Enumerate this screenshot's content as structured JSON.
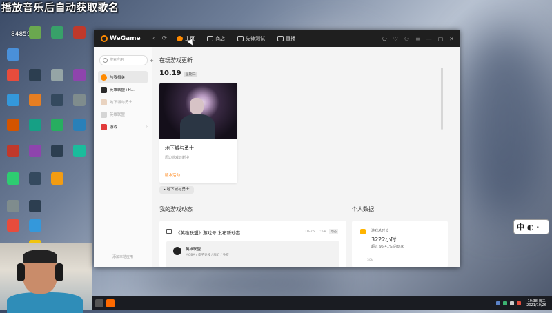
{
  "overlay": {
    "title": "播放音乐后自动获取歌名",
    "counter": "8485959"
  },
  "window": {
    "app_name": "WeGame",
    "nav": {
      "back": "‹",
      "refresh": "⟳"
    },
    "tabs": [
      {
        "label": "主页",
        "active": true
      },
      {
        "label": "商店",
        "active": false
      },
      {
        "label": "先锋测试",
        "active": false
      },
      {
        "label": "直播",
        "active": false
      }
    ],
    "title_controls": [
      "⎔",
      "♡",
      "⚇",
      "≡",
      "—",
      "▢",
      "✕"
    ]
  },
  "sidebar": {
    "search_placeholder": "搜索应用",
    "add": "+",
    "items": [
      {
        "label": "与我相关",
        "color": "#ff8a00"
      },
      {
        "label": "英雄联盟+H...",
        "color": "#2b2b2b"
      },
      {
        "label": "地下城与勇士",
        "color": "#e9d3c0"
      },
      {
        "label": "英雄联盟",
        "color": "#d5d5d5"
      },
      {
        "label": "游戏",
        "color": "#e23b3b"
      }
    ],
    "footer": "添加本地应用"
  },
  "main": {
    "section_title": "在玩游戏更新",
    "date": "10.19",
    "weekday": "星期二",
    "card": {
      "title": "地下城与勇士",
      "subtitle": "周边游戏诊断中",
      "action": "版本活动"
    },
    "game_pill": "地下城与勇士",
    "feed_heading": "我的游戏动态",
    "stats_heading": "个人数据",
    "feed": {
      "headline": "《英雄联盟》游戏号 发布新动态",
      "time": "10-26 17:54",
      "badge": "动态",
      "game_name": "英雄联盟",
      "game_tags": "MOBA / 电子竞技 / 魔幻 / 免费"
    },
    "stats": {
      "label": "游戏总时长",
      "value": "3222小时",
      "sub": "超过 95.41% 的玩家",
      "more": "30k"
    }
  },
  "ime": {
    "label": "中"
  },
  "taskbar": {
    "time": "19:38 周二",
    "date": "2021/10/26"
  }
}
